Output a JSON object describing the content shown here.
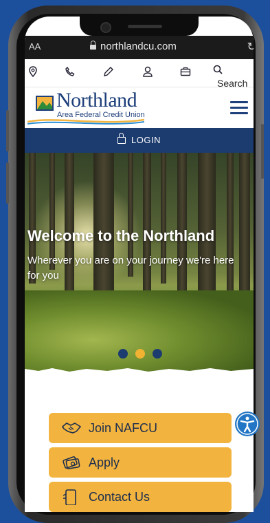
{
  "browser": {
    "text_size_label": "AA",
    "url": "northlandcu.com",
    "reload_icon": "reload-icon"
  },
  "toolbar": {
    "icons": [
      "location-icon",
      "phone-icon",
      "pencil-icon",
      "user-icon",
      "briefcase-icon",
      "search-icon"
    ],
    "search_label": "Search"
  },
  "logo": {
    "name": "Northland",
    "subtitle": "Area Federal Credit Union"
  },
  "login": {
    "label": "LOGIN"
  },
  "hero": {
    "title": "Welcome to the Northland",
    "subtitle": "Wherever you are on your journey we're here for you",
    "slide_count": 3,
    "active_slide": 2
  },
  "actions": [
    {
      "label": "Join NAFCU",
      "icon": "handshake-icon"
    },
    {
      "label": "Apply",
      "icon": "money-icon"
    },
    {
      "label": "Contact Us",
      "icon": "phone-icon"
    }
  ],
  "colors": {
    "brand_navy": "#1c3b6e",
    "brand_gold": "#f2b43f",
    "background_blue": "#1c4f9c",
    "accessibility_blue": "#2276c5"
  }
}
